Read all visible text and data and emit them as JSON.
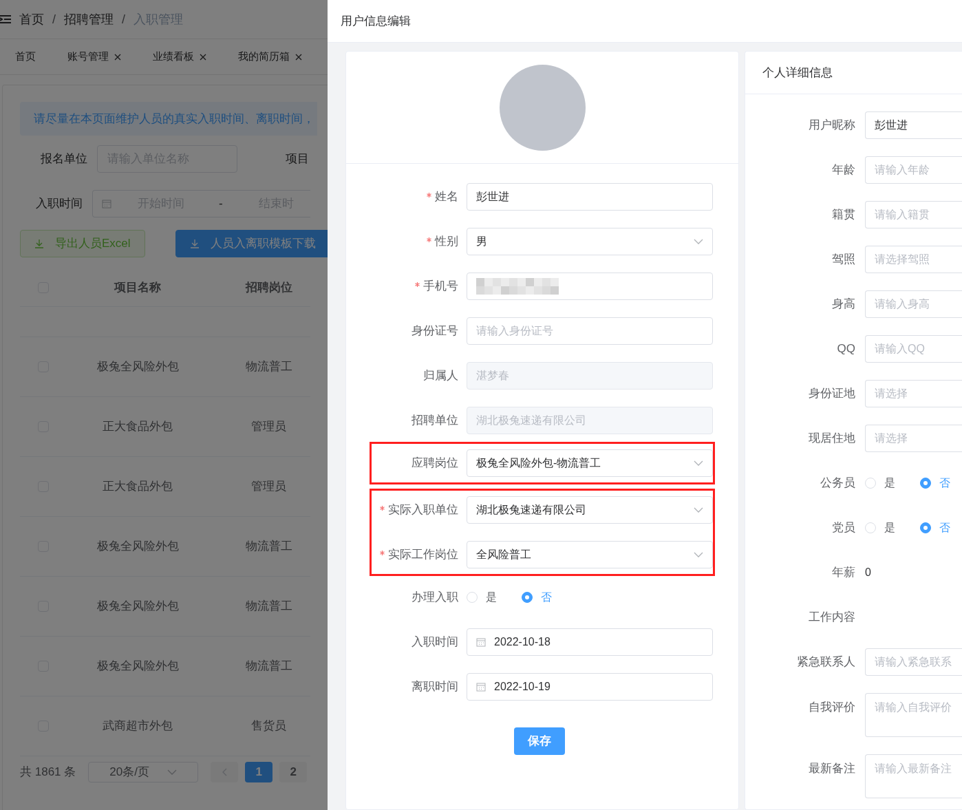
{
  "breadcrumb": {
    "items": [
      "首页",
      "招聘管理",
      "入职管理"
    ],
    "separators": [
      "/",
      "/"
    ]
  },
  "tabs": [
    {
      "label": "首页",
      "closable": false,
      "selected": false
    },
    {
      "label": "账号管理",
      "closable": true,
      "selected": false
    },
    {
      "label": "业绩看板",
      "closable": true,
      "selected": false
    },
    {
      "label": "我的简历箱",
      "closable": true,
      "selected": false
    }
  ],
  "notice": "请尽量在本页面维护人员的真实入职时间、离职时间，",
  "filters": [
    {
      "label": "报名单位",
      "placeholder": "请输入单位名称",
      "side_label": "项目"
    },
    {
      "label": "入职时间",
      "start_placeholder": "开始时间",
      "separator": "-",
      "end_placeholder": "结束时"
    }
  ],
  "actions": [
    {
      "label": "导出人员Excel",
      "kind": "success"
    },
    {
      "label": "人员入离职模板下载",
      "kind": "primary"
    }
  ],
  "table": {
    "columns": [
      "项目名称",
      "招聘岗位"
    ],
    "all_checked": false,
    "rows": [
      {
        "project": "极兔全风险外包",
        "position": "物流普工",
        "checked": false
      },
      {
        "project": "正大食品外包",
        "position": "管理员",
        "checked": false
      },
      {
        "project": "正大食品外包",
        "position": "管理员",
        "checked": false
      },
      {
        "project": "极兔全风险外包",
        "position": "物流普工",
        "checked": false
      },
      {
        "project": "极兔全风险外包",
        "position": "物流普工",
        "checked": false
      },
      {
        "project": "极兔全风险外包",
        "position": "物流普工",
        "checked": false
      },
      {
        "project": "武商超市外包",
        "position": "售货员",
        "checked": false
      }
    ]
  },
  "pagination": {
    "total": "共 1861 条",
    "page_size": "20条/页",
    "pages": [
      {
        "label": "1",
        "selected": true
      },
      {
        "label": "2",
        "selected": false
      }
    ]
  },
  "drawer": {
    "title": "用户信息编辑",
    "form_groups": [
      {
        "highlighted": false,
        "fields": [
          {
            "label": "姓名",
            "required": true,
            "kind": "input",
            "value": "彭世进"
          },
          {
            "label": "性别",
            "required": true,
            "kind": "select",
            "value": "男"
          },
          {
            "label": "手机号",
            "required": true,
            "kind": "masked"
          },
          {
            "label": "身份证号",
            "required": false,
            "kind": "input",
            "placeholder": "请输入身份证号"
          },
          {
            "label": "归属人",
            "required": false,
            "kind": "disabled",
            "value": "湛梦春"
          },
          {
            "label": "招聘单位",
            "required": false,
            "kind": "disabled",
            "value": "湖北极兔速递有限公司"
          }
        ]
      },
      {
        "highlighted": true,
        "fields": [
          {
            "label": "应聘岗位",
            "required": false,
            "kind": "select",
            "value": "极兔全风险外包-物流普工"
          }
        ]
      },
      {
        "highlighted": true,
        "fields": [
          {
            "label": "实际入职单位",
            "required": true,
            "kind": "select",
            "value": "湖北极兔速递有限公司"
          },
          {
            "label": "实际工作岗位",
            "required": true,
            "kind": "select",
            "value": "全风险普工"
          }
        ]
      },
      {
        "highlighted": false,
        "fields": [
          {
            "label": "办理入职",
            "required": false,
            "kind": "radio",
            "options": [
              {
                "label": "是",
                "selected": false
              },
              {
                "label": "否",
                "selected": true
              }
            ]
          },
          {
            "label": "入职时间",
            "required": false,
            "kind": "date",
            "value": "2022-10-18"
          },
          {
            "label": "离职时间",
            "required": false,
            "kind": "date",
            "value": "2022-10-19"
          }
        ]
      }
    ],
    "save_button": "保存",
    "details": {
      "title": "个人详细信息",
      "fields": [
        {
          "label": "用户昵称",
          "kind": "input",
          "value": "彭世进"
        },
        {
          "label": "年龄",
          "kind": "input",
          "placeholder": "请输入年龄"
        },
        {
          "label": "籍贯",
          "kind": "input",
          "placeholder": "请输入籍贯"
        },
        {
          "label": "驾照",
          "kind": "input",
          "placeholder": "请选择驾照"
        },
        {
          "label": "身高",
          "kind": "input",
          "placeholder": "请输入身高"
        },
        {
          "label": "QQ",
          "kind": "input",
          "placeholder": "请输入QQ"
        },
        {
          "label": "身份证地",
          "kind": "input",
          "placeholder": "请选择"
        },
        {
          "label": "现居住地",
          "kind": "input",
          "placeholder": "请选择"
        },
        {
          "label": "公务员",
          "kind": "radio",
          "options": [
            {
              "label": "是",
              "selected": false
            },
            {
              "label": "否",
              "selected": true
            }
          ]
        },
        {
          "label": "党员",
          "kind": "radio",
          "options": [
            {
              "label": "是",
              "selected": false
            },
            {
              "label": "否",
              "selected": true
            }
          ]
        },
        {
          "label": "年薪",
          "kind": "text",
          "value": "0"
        },
        {
          "label": "工作内容",
          "kind": "empty"
        },
        {
          "label": "紧急联系人",
          "kind": "input",
          "placeholder": "请输入紧急联系"
        },
        {
          "label": "自我评价",
          "kind": "textarea",
          "placeholder": "请输入自我评价"
        },
        {
          "label": "最新备注",
          "kind": "textarea",
          "placeholder": "请输入最新备注"
        }
      ]
    }
  }
}
